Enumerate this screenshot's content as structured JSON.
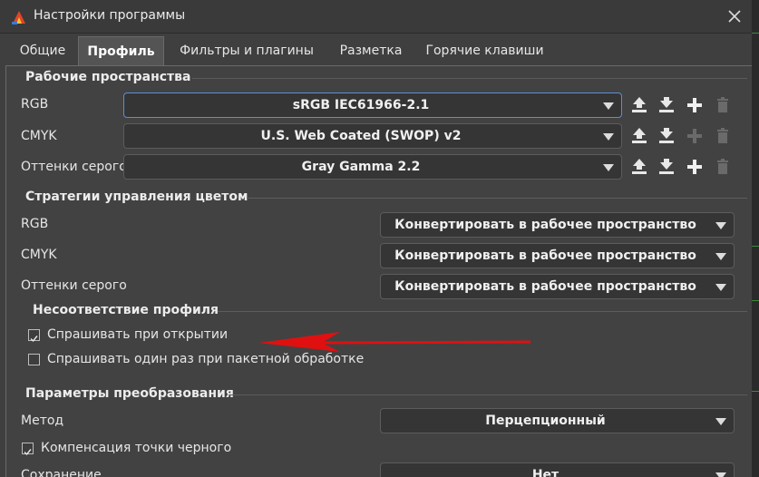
{
  "window": {
    "title": "Настройки программы",
    "app_icon": "app-logo-icon",
    "close_icon": "close-icon"
  },
  "tabs": [
    {
      "label": "Общие",
      "active": false
    },
    {
      "label": "Профиль",
      "active": true
    },
    {
      "label": "Фильтры и плагины",
      "active": false
    },
    {
      "label": "Разметка",
      "active": false
    },
    {
      "label": "Горячие клавиши",
      "active": false
    }
  ],
  "workspaces": {
    "title": "Рабочие пространства",
    "rows": [
      {
        "label": "RGB",
        "value": "sRGB IEC61966-2.1",
        "add_enabled": true,
        "delete_enabled": false
      },
      {
        "label": "CMYK",
        "value": "U.S. Web Coated (SWOP) v2",
        "add_enabled": false,
        "delete_enabled": false
      },
      {
        "label": "Оттенки серого",
        "value": "Gray Gamma 2.2",
        "add_enabled": true,
        "delete_enabled": false
      }
    ],
    "icons": [
      "upload-icon",
      "download-icon",
      "plus-icon",
      "trash-icon"
    ]
  },
  "strategies": {
    "title": "Стратегии управления цветом",
    "rows": [
      {
        "label": "RGB",
        "value": "Конвертировать в рабочее пространство"
      },
      {
        "label": "CMYK",
        "value": "Конвертировать в рабочее пространство"
      },
      {
        "label": "Оттенки серого",
        "value": "Конвертировать в рабочее пространство"
      }
    ]
  },
  "mismatch": {
    "title": "Несоответствие профиля",
    "ask_on_open": {
      "label": "Спрашивать при открытии",
      "checked": true
    },
    "ask_once_batch": {
      "label": "Спрашивать один раз при пакетной обработке",
      "checked": false
    }
  },
  "conversion": {
    "title": "Параметры преобразования",
    "method_label": "Метод",
    "method_value": "Перцепционный",
    "black_point": {
      "label": "Компенсация точки черного",
      "checked": true
    },
    "save_label": "Сохранение",
    "save_value": "Нет"
  },
  "colors": {
    "accent_focus": "#5b8fd6",
    "annotation_arrow": "#e01010"
  }
}
